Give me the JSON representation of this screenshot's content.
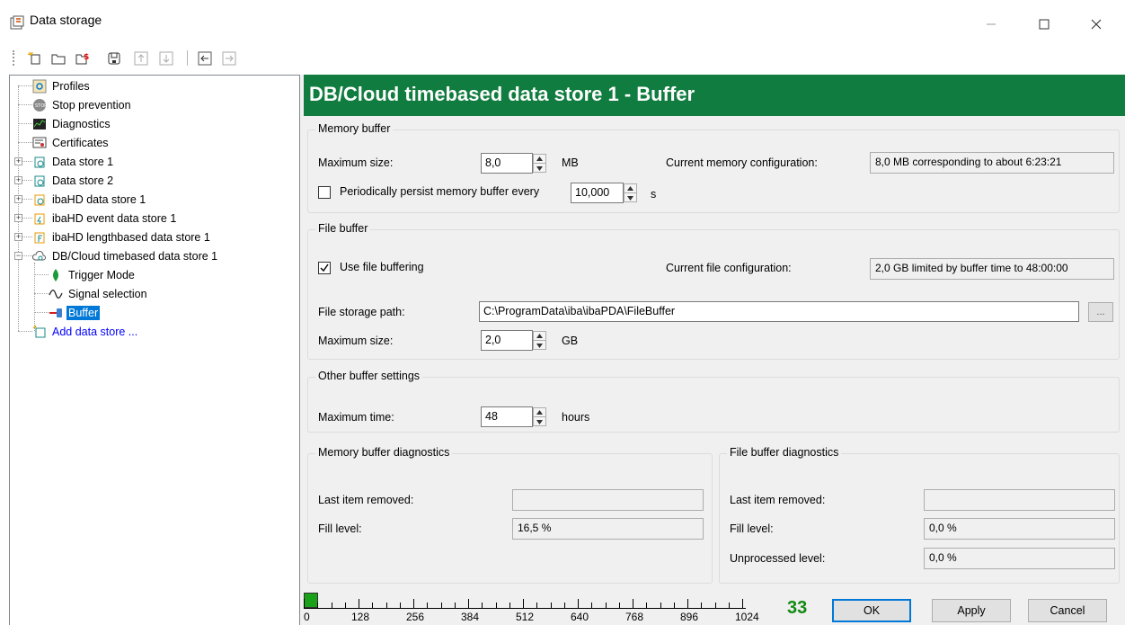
{
  "window": {
    "title": "Data storage",
    "icon": "data-storage-icon"
  },
  "toolbar": {
    "buttons": [
      {
        "name": "new-data-store-icon"
      },
      {
        "name": "open-folder-icon"
      },
      {
        "name": "data-store-settings-icon"
      },
      {
        "name": "save-icon"
      },
      {
        "name": "move-up-icon"
      },
      {
        "name": "move-down-icon"
      },
      {
        "name": "collapse-left-icon"
      },
      {
        "name": "expand-right-icon"
      }
    ]
  },
  "tree": {
    "items": [
      {
        "label": "Profiles",
        "icon": "profiles-icon"
      },
      {
        "label": "Stop prevention",
        "icon": "stop-icon"
      },
      {
        "label": "Diagnostics",
        "icon": "diagnostics-icon"
      },
      {
        "label": "Certificates",
        "icon": "certificate-icon"
      },
      {
        "label": "Data store 1",
        "icon": "data-store-icon"
      },
      {
        "label": "Data store 2",
        "icon": "data-store-icon"
      },
      {
        "label": "ibaHD data store 1",
        "icon": "ibahd-store-icon"
      },
      {
        "label": "ibaHD event data store 1",
        "icon": "ibahd-event-store-icon"
      },
      {
        "label": "ibaHD lengthbased data store 1",
        "icon": "ibahd-length-store-icon"
      },
      {
        "label": "DB/Cloud timebased data store 1",
        "icon": "cloud-store-icon"
      },
      {
        "label": "Trigger Mode",
        "icon": "trigger-icon"
      },
      {
        "label": "Signal selection",
        "icon": "signal-icon"
      },
      {
        "label": "Buffer",
        "icon": "buffer-icon"
      },
      {
        "label": "Add data store ...",
        "icon": "add-store-icon"
      }
    ]
  },
  "header": {
    "title": "DB/Cloud timebased data store 1 - Buffer"
  },
  "memory_buffer": {
    "title": "Memory buffer",
    "max_size_label": "Maximum size:",
    "max_size_value": "8,0",
    "max_size_unit": "MB",
    "current_config_label": "Current memory configuration:",
    "current_config_value": "8,0 MB corresponding to about 6:23:21",
    "persist_label": "Periodically persist memory buffer every",
    "persist_checked": false,
    "persist_value": "10,000",
    "persist_unit": "s"
  },
  "file_buffer": {
    "title": "File buffer",
    "use_label": "Use file buffering",
    "use_checked": true,
    "current_config_label": "Current file configuration:",
    "current_config_value": "2,0 GB limited by buffer time to 48:00:00",
    "path_label": "File storage path:",
    "path_value": "C:\\ProgramData\\iba\\ibaPDA\\FileBuffer",
    "browse_label": "...",
    "max_size_label": "Maximum size:",
    "max_size_value": "2,0",
    "max_size_unit": "GB"
  },
  "other_buffer": {
    "title": "Other buffer settings",
    "max_time_label": "Maximum time:",
    "max_time_value": "48",
    "max_time_unit": "hours"
  },
  "memory_diag": {
    "title": "Memory buffer diagnostics",
    "last_removed_label": "Last item removed:",
    "last_removed_value": "",
    "fill_label": "Fill level:",
    "fill_value": "16,5 %"
  },
  "file_diag": {
    "title": "File buffer diagnostics",
    "last_removed_label": "Last item removed:",
    "last_removed_value": "",
    "fill_label": "Fill level:",
    "fill_value": "0,0 %",
    "unprocessed_label": "Unprocessed level:",
    "unprocessed_value": "0,0 %"
  },
  "status": {
    "ruler_labels": [
      "0",
      "128",
      "256",
      "384",
      "512",
      "640",
      "768",
      "896",
      "1024"
    ],
    "counter": "33",
    "indicator_color": "#1aa11a"
  },
  "buttons": {
    "ok": "OK",
    "apply": "Apply",
    "cancel": "Cancel"
  },
  "colors": {
    "header": "#107c3f",
    "selection": "#0078d7",
    "link": "#0000ff"
  }
}
